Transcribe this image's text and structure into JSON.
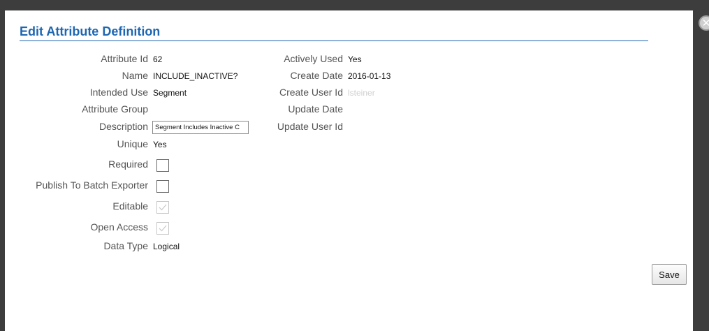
{
  "dialog": {
    "title": "Edit Attribute Definition",
    "close_icon": "close-circle-icon"
  },
  "left_fields": [
    {
      "label": "Attribute Id",
      "value": "62"
    },
    {
      "label": "Name",
      "value": "INCLUDE_INACTIVE?"
    },
    {
      "label": "Intended Use",
      "value": "Segment"
    },
    {
      "label": "Attribute Group",
      "value": ""
    },
    {
      "label": "Description",
      "value": "Segment Includes Inactive C"
    },
    {
      "label": "Unique",
      "value": "Yes"
    },
    {
      "label": "Required",
      "checked": false,
      "disabled": false
    },
    {
      "label": "Publish To Batch Exporter",
      "checked": false,
      "disabled": false
    },
    {
      "label": "Editable",
      "checked": true,
      "disabled": true
    },
    {
      "label": "Open Access",
      "checked": true,
      "disabled": true
    },
    {
      "label": "Data Type",
      "value": "Logical"
    }
  ],
  "right_fields": [
    {
      "label": "Actively Used",
      "value": "Yes"
    },
    {
      "label": "Create Date",
      "value": "2016-01-13"
    },
    {
      "label": "Create User Id",
      "value": "lsteiner"
    },
    {
      "label": "Update Date",
      "value": ""
    },
    {
      "label": "Update User Id",
      "value": ""
    }
  ],
  "actions": {
    "save_label": "Save"
  },
  "colors": {
    "title": "#1d66b1",
    "label": "#555555",
    "muted_value": "#cfcfcf"
  }
}
